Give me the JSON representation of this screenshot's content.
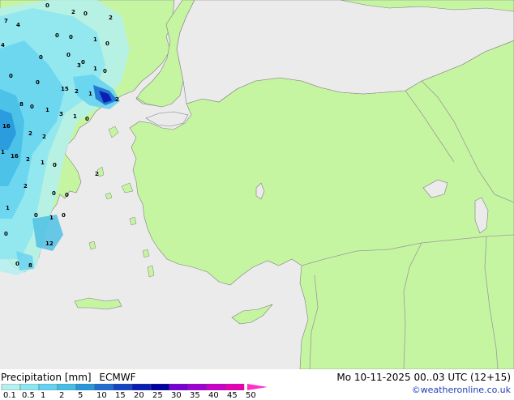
{
  "title": "Precipitation [mm]",
  "model": "ECMWF",
  "valid_time": "Mo 10-11-2025 00..03 UTC (12+15)",
  "credit": "©weatheronline.co.uk",
  "colors": {
    "sea": "#ebebeb",
    "land": "#c6f5a2",
    "border": "#9a9a9a",
    "coast": "#7f7f7f"
  },
  "legend": {
    "ticks": [
      "0.1",
      "0.5",
      "1",
      "2",
      "5",
      "10",
      "15",
      "20",
      "25",
      "30",
      "35",
      "40",
      "45",
      "50"
    ],
    "colors": [
      "#b4f0f0",
      "#8ce6f0",
      "#64d2f0",
      "#46bee6",
      "#2898dc",
      "#1e6ed2",
      "#1446c3",
      "#0a1eb4",
      "#0000a0",
      "#7800d2",
      "#a000d2",
      "#c800c8",
      "#e600b4",
      "#ff32c8"
    ]
  },
  "map_values": [
    "0",
    "2",
    "0",
    "2",
    "7",
    "4",
    "0",
    "0",
    "1",
    "0",
    "4",
    "0",
    "0",
    "0",
    "3",
    "0",
    "1",
    "0",
    "15",
    "2",
    "1",
    "0",
    "2",
    "0",
    "1",
    "3",
    "1",
    "0",
    "8",
    "16",
    "2",
    "2",
    "1",
    "16",
    "2",
    "1",
    "0",
    "2",
    "0",
    "0",
    "2",
    "1",
    "0",
    "0",
    "1",
    "12",
    "0",
    "8",
    "0"
  ]
}
